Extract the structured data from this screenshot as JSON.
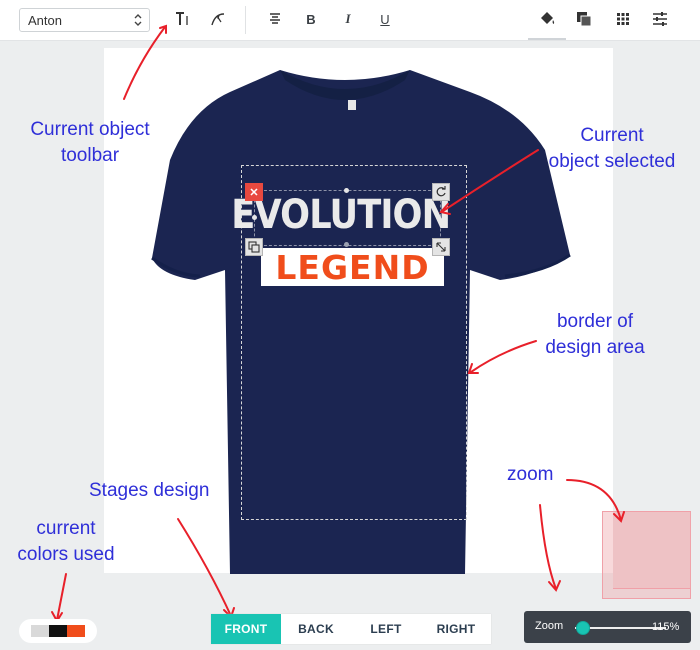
{
  "toolbar": {
    "font_value": "Anton",
    "text_tool_icon": "text-format-icon",
    "curve_tool_icon": "curve-text-icon",
    "align_icon": "align-center-icon",
    "bold_label": "B",
    "italic_label": "I",
    "underline_label": "U",
    "fill_icon": "paint-bucket-icon",
    "layers_icon": "layers-icon",
    "grid_icon": "grid-icon",
    "settings_icon": "sliders-icon"
  },
  "design": {
    "line1": "EVOLUTION",
    "line2": "LEGEND",
    "shirt_color": "#1b2551",
    "line1_color": "#eaeaea",
    "line2_color": "#f04d1b"
  },
  "annotations": {
    "toolbar_note_1": "Current object",
    "toolbar_note_2": "toolbar",
    "selected_note_1": "Current",
    "selected_note_2": "object selected",
    "border_note_1": "border of",
    "border_note_2": "design area",
    "stages_note": "Stages design",
    "colors_note_1": "current",
    "colors_note_2": "colors used",
    "zoom_note": "zoom"
  },
  "colors_used": [
    "#d9d9d9",
    "#111111",
    "#f04d1b"
  ],
  "stages": [
    "FRONT",
    "BACK",
    "LEFT",
    "RIGHT"
  ],
  "active_stage": "FRONT",
  "zoom": {
    "label": "Zoom",
    "value": "115%",
    "slider_fraction": 0.0
  },
  "accent_color": "#19c4b3",
  "annotation_color": "#2f2fd8",
  "arrow_color": "#e8202a"
}
